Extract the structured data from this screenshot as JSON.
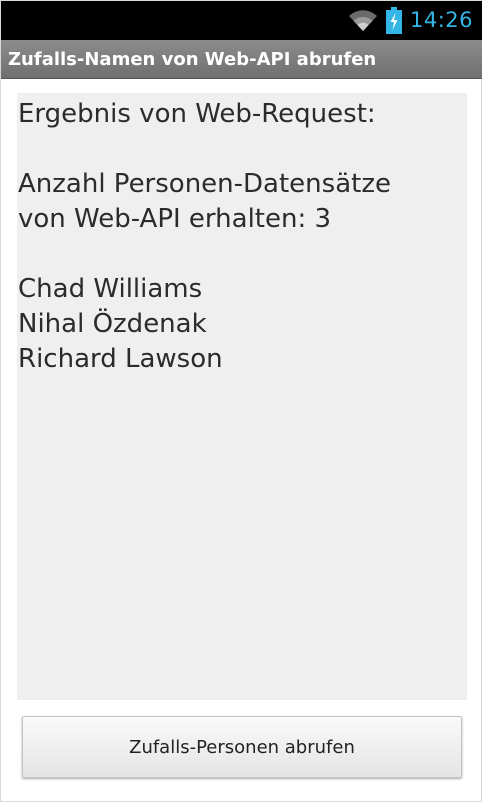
{
  "status_bar": {
    "time": "14:26",
    "icons": [
      "wifi-icon",
      "battery-charging-icon"
    ],
    "accent_color": "#33b5e5"
  },
  "app": {
    "title": "Zufalls-Namen von Web-API abrufen"
  },
  "result": {
    "heading": "Ergebnis von Web-Request:",
    "count_line_1": "Anzahl Personen-Datensätze",
    "count_line_2": "von Web-API erhalten: 3",
    "names": [
      "Chad Williams",
      "Nihal Özdenak",
      "Richard Lawson"
    ]
  },
  "button": {
    "label": "Zufalls-Personen abrufen"
  }
}
